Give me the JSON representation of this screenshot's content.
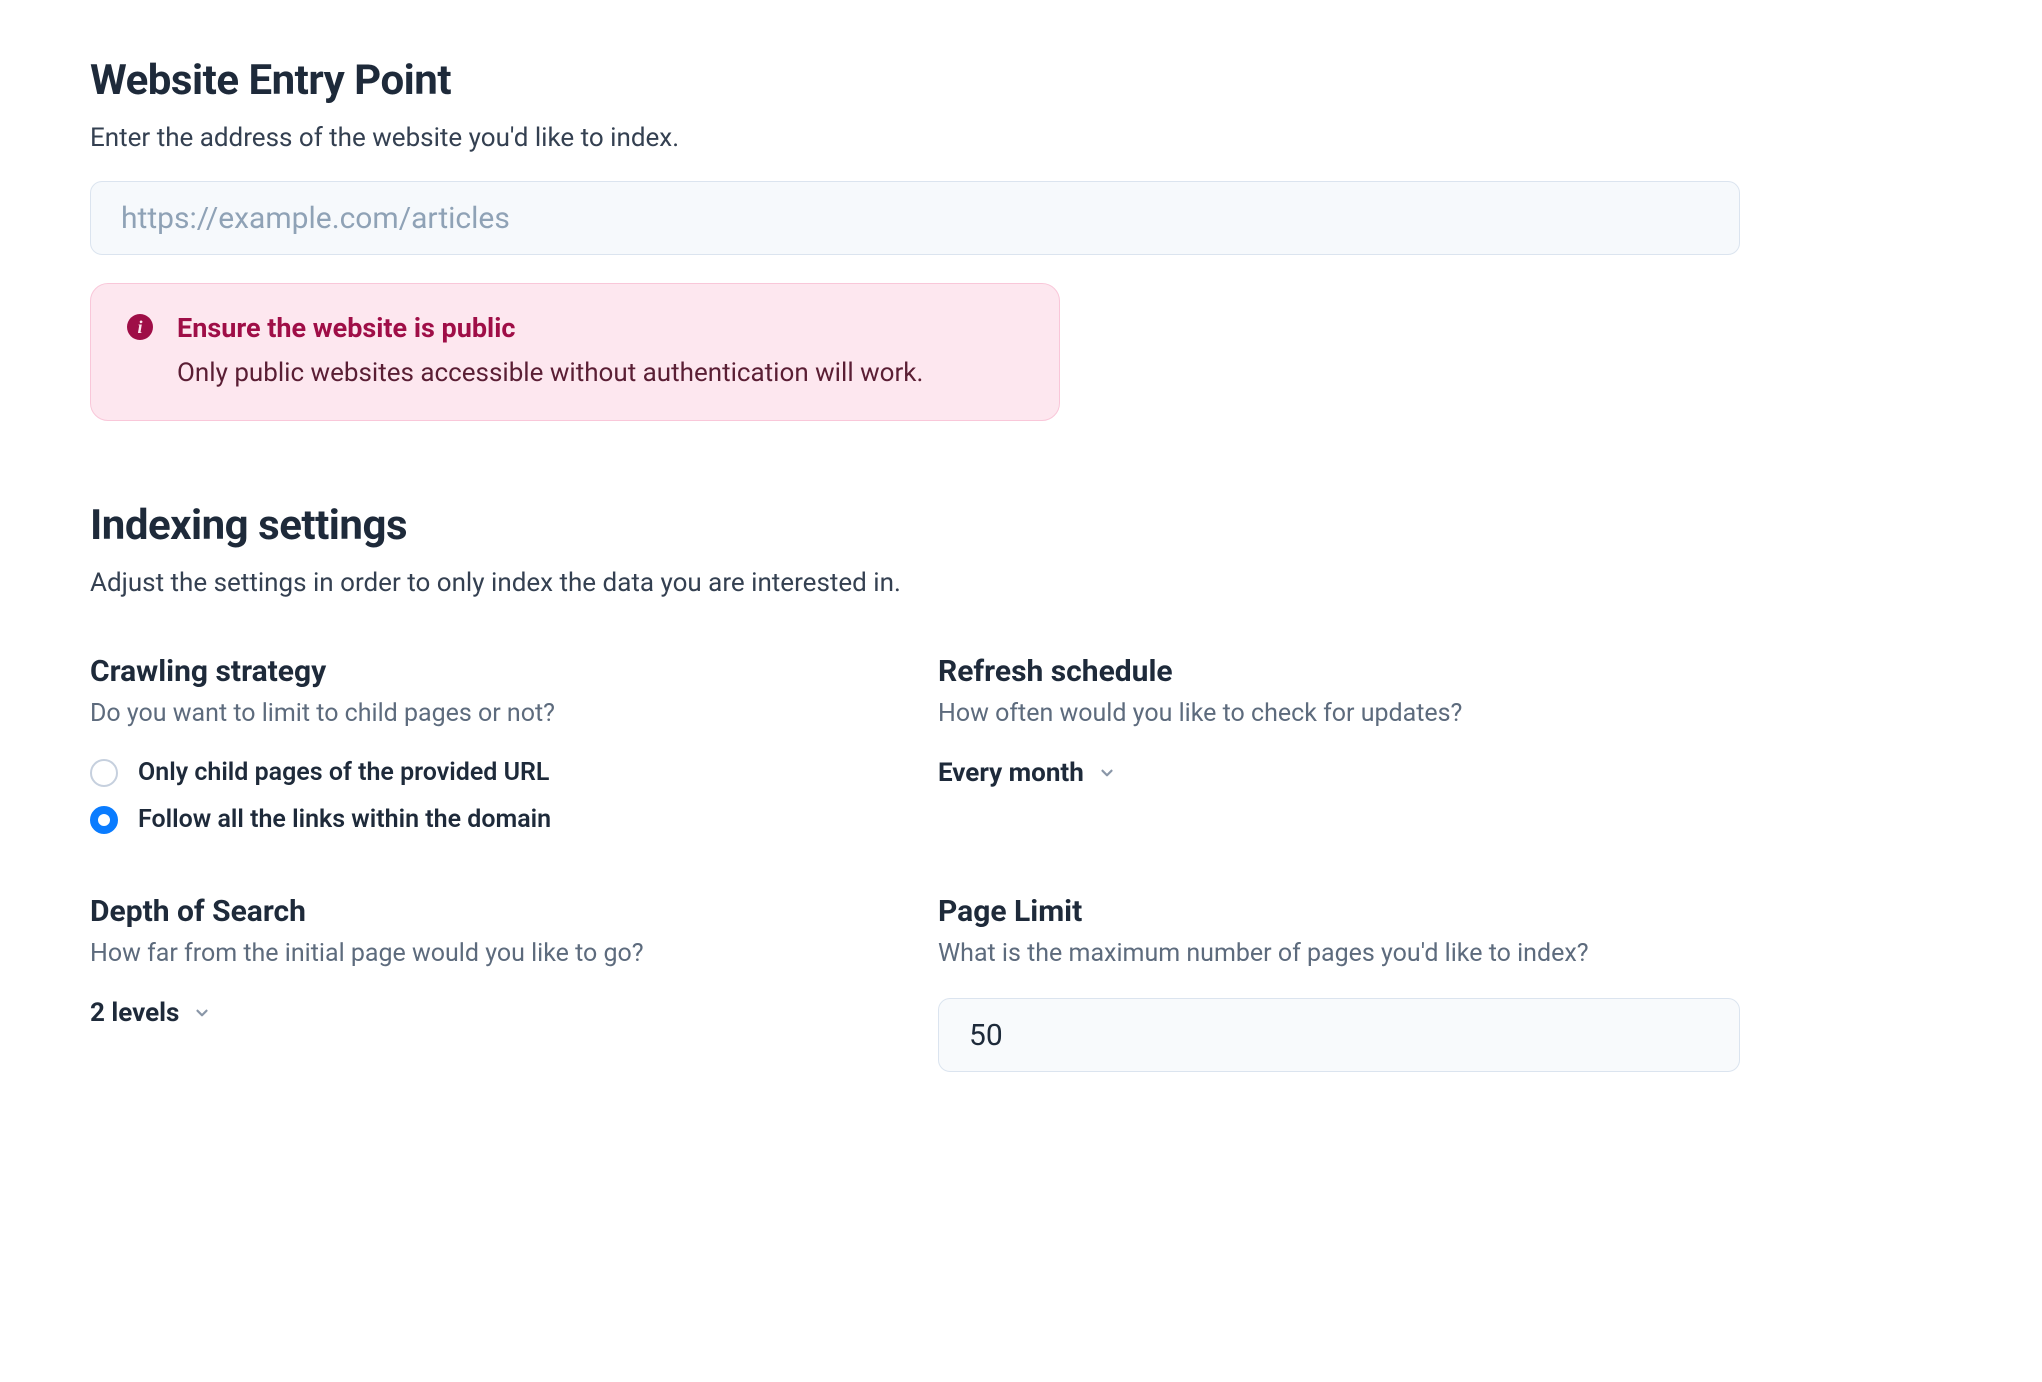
{
  "entry": {
    "title": "Website Entry Point",
    "desc": "Enter the address of the website you'd like to index.",
    "url_value": "",
    "url_placeholder": "https://example.com/articles"
  },
  "alert": {
    "title": "Ensure the website is public",
    "text": "Only public websites accessible without authentication will work."
  },
  "settings": {
    "title": "Indexing settings",
    "desc": "Adjust the settings in order to only index the data you are interested in."
  },
  "crawling": {
    "title": "Crawling strategy",
    "desc": "Do you want to limit to child pages or not?",
    "options": {
      "child": "Only child pages of the provided URL",
      "follow": "Follow all the links within the domain"
    },
    "selected": "follow"
  },
  "refresh": {
    "title": "Refresh schedule",
    "desc": "How often would you like to check for updates?",
    "value": "Every month"
  },
  "depth": {
    "title": "Depth of Search",
    "desc": "How far from the initial page would you like to go?",
    "value": "2 levels"
  },
  "limit": {
    "title": "Page Limit",
    "desc": "What is the maximum number of pages you'd like to index?",
    "value": "50"
  }
}
